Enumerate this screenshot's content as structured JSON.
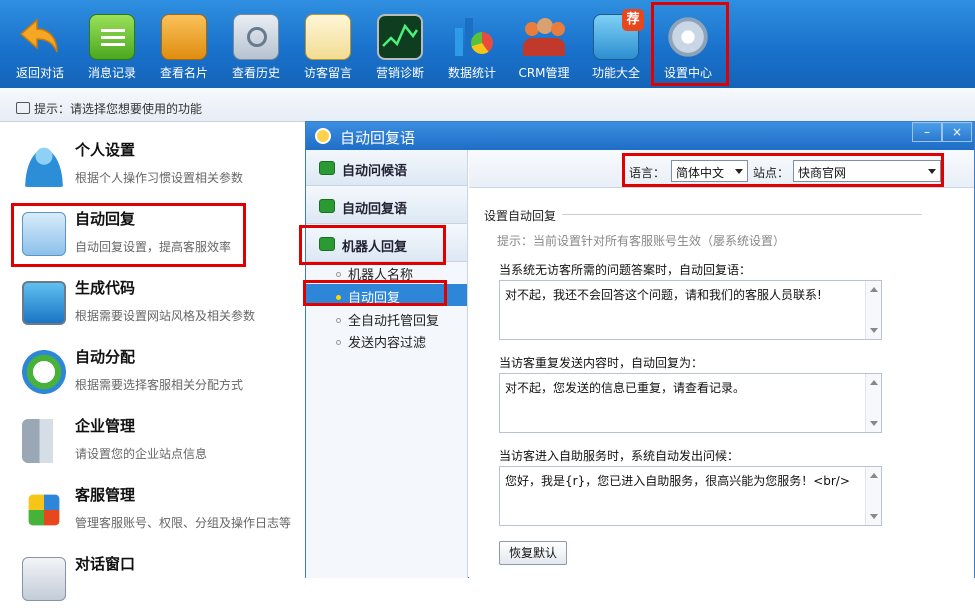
{
  "toolbar": {
    "items": [
      {
        "label": "返回对话",
        "icon": "back-arrow-icon"
      },
      {
        "label": "消息记录",
        "icon": "message-icon"
      },
      {
        "label": "查看名片",
        "icon": "card-icon"
      },
      {
        "label": "查看历史",
        "icon": "history-icon"
      },
      {
        "label": "访客留言",
        "icon": "note-icon"
      },
      {
        "label": "营销诊断",
        "icon": "chart-icon"
      },
      {
        "label": "数据统计",
        "icon": "stats-icon"
      },
      {
        "label": "CRM管理",
        "icon": "people-icon"
      },
      {
        "label": "功能大全",
        "icon": "apps-icon",
        "badge": "荐"
      },
      {
        "label": "设置中心",
        "icon": "gear-icon"
      }
    ]
  },
  "hint": {
    "text": "提示：请选择您想要使用的功能"
  },
  "left_items": [
    {
      "title": "个人设置",
      "desc": "根据个人操作习惯设置相关参数"
    },
    {
      "title": "自动回复",
      "desc": "自动回复设置，提高客服效率"
    },
    {
      "title": "生成代码",
      "desc": "根据需要设置网站风格及相关参数"
    },
    {
      "title": "自动分配",
      "desc": "根据需要选择客服相关分配方式"
    },
    {
      "title": "企业管理",
      "desc": "请设置您的企业站点信息"
    },
    {
      "title": "客服管理",
      "desc": "管理客服账号、权限、分组及操作日志等"
    },
    {
      "title": "对话窗口",
      "desc": ""
    }
  ],
  "dialog": {
    "title": "自动回复语",
    "min_label": "–",
    "close_label": "×",
    "tabs": [
      "自动问候语",
      "自动回复语",
      "机器人回复"
    ],
    "sub_items": [
      "机器人名称",
      "自动回复",
      "全自动托管回复",
      "发送内容过滤"
    ],
    "lang_label": "语言：",
    "lang_value": "简体中文",
    "site_label": "站点：",
    "site_value": "快商官网",
    "section_title": "设置自动回复",
    "tip": "提示：当前设置针对所有客服账号生效（屡系统设置）",
    "q1": "当系统无访客所需的问题答案时，自动回复语：",
    "a1": "对不起，我还不会回答这个问题，请和我们的客服人员联系!",
    "q2": "当访客重复发送内容时，自动回复为：",
    "a2": "对不起，您发送的信息已重复，请查看记录。",
    "q3": "当访客进入自助服务时，系统自动发出问候：",
    "a3": "您好，我是{r}，您已进入自助服务，很高兴能为您服务！<br/>",
    "reset_label": "恢复默认"
  }
}
